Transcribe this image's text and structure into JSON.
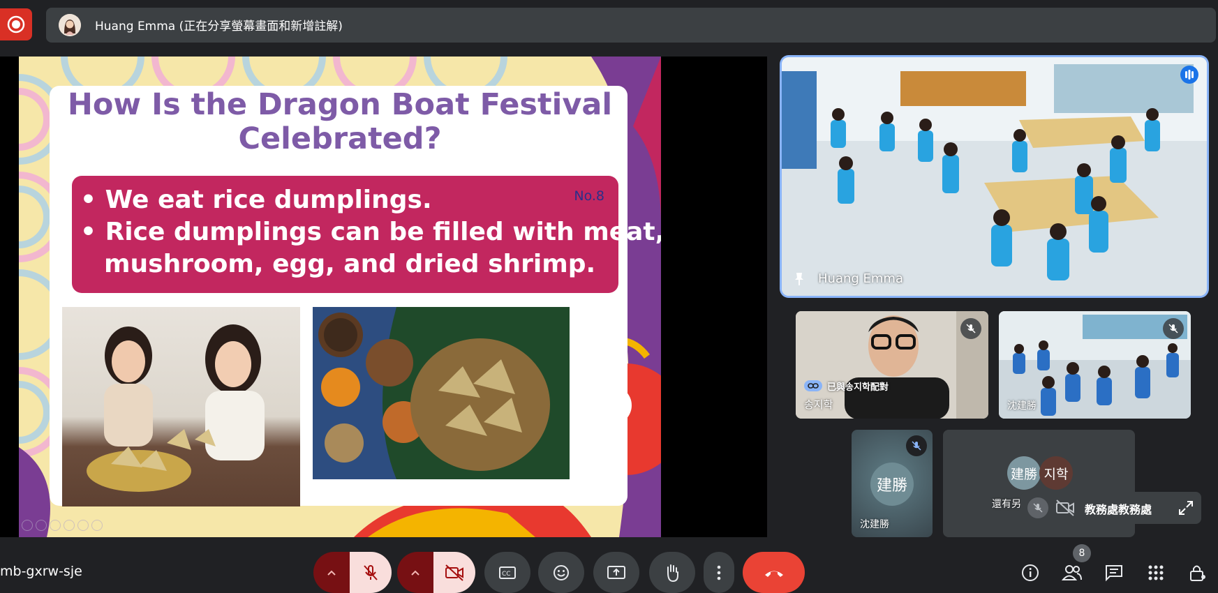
{
  "header": {
    "presenter_title": "Huang Emma (正在分享螢幕畫面和新增註解)",
    "record_icon": "record-icon"
  },
  "slide": {
    "title": "How Is the Dragon Boat Festival Celebrated?",
    "title_line1": "How Is the Dragon Boat Festival",
    "title_line2": "Celebrated?",
    "number": "No.8",
    "bullets": [
      "We eat rice dumplings.",
      "Rice dumplings can be filled with meat,",
      "mushroom, egg, and dried shrimp."
    ],
    "bullet_mark": "•",
    "colors": {
      "title": "#7e5ba7",
      "bullet_box": "#c2275f"
    }
  },
  "tiles": {
    "main": {
      "name": "Huang Emma",
      "pin_icon": "pin-icon",
      "audio_icon": "speaking-indicator-icon"
    },
    "tile1": {
      "paired_label": "已與송지학配對",
      "name": "송지학"
    },
    "tile2": {
      "name": "沈建勝"
    },
    "tile3": {
      "avatar_text": "建勝",
      "name": "沈建勝"
    },
    "tile4": {
      "avatar_a": "建勝",
      "avatar_b": "지학",
      "name": "還有另"
    },
    "self": {
      "name": "教務處教務處"
    }
  },
  "bottom": {
    "meeting_code": "mb-gxrw-sje",
    "people_count": "8"
  },
  "colors": {
    "accent": "#8ab4f8",
    "danger": "#ea4335",
    "bar": "#202124"
  }
}
